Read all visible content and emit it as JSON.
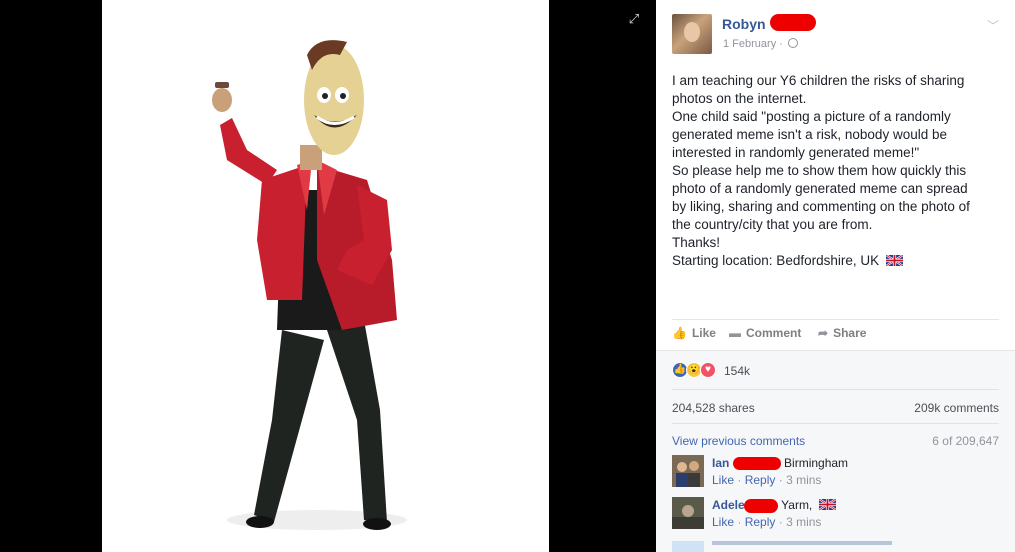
{
  "post": {
    "author": "Robyn",
    "date": "1 February",
    "lines": [
      "I am teaching our Y6 children the risks of sharing",
      "photos on the internet.",
      "One child said \"posting a picture of a randomly",
      "generated meme isn't a risk, nobody would be",
      "interested in randomly generated meme!\"",
      "So please help me to show them how quickly this",
      "photo of a randomly generated meme can spread",
      "by liking, sharing and commenting on the photo of",
      "the country/city that you are from.",
      "Thanks!",
      "Starting location: Bedfordshire, UK"
    ]
  },
  "actions": {
    "like": "Like",
    "comment": "Comment",
    "share": "Share"
  },
  "stats": {
    "reactions_count": "154k",
    "shares": "204,528 shares",
    "comments": "209k comments"
  },
  "comments_section": {
    "view_previous": "View previous comments",
    "paging": "6 of 209,647",
    "items": [
      {
        "name": "Ian",
        "text": "Birmingham",
        "like": "Like",
        "reply": "Reply",
        "time": "3 mins",
        "flag": false
      },
      {
        "name": "Adele",
        "text": "Yarm,",
        "like": "Like",
        "reply": "Reply",
        "time": "3 mins",
        "flag": true
      }
    ]
  },
  "colors": {
    "link": "#365899",
    "redaction": "#ee0000",
    "jacket": "#c8202e"
  },
  "icons": [
    "expand-icon",
    "globe-icon",
    "chevron-down-icon",
    "like-icon",
    "comment-icon",
    "share-icon",
    "uk-flag-icon"
  ]
}
